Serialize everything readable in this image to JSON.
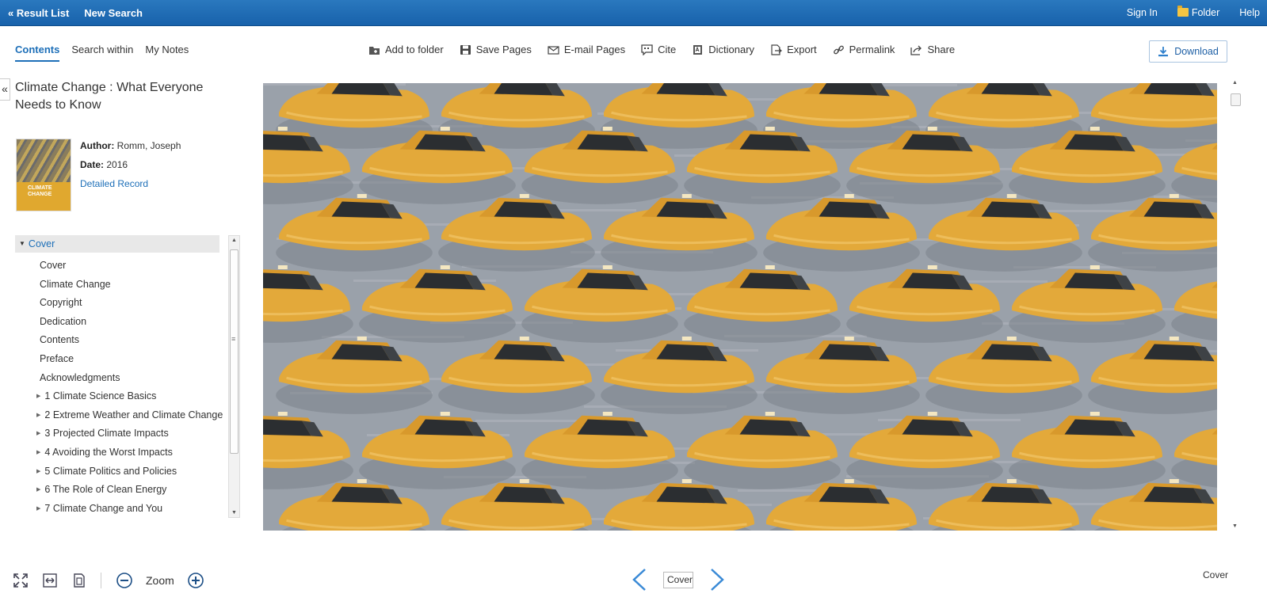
{
  "topbar": {
    "result_list": "« Result List",
    "new_search": "New Search",
    "sign_in": "Sign In",
    "folder": "Folder",
    "help": "Help"
  },
  "tabs": [
    "Contents",
    "Search within",
    "My Notes"
  ],
  "toolbar": {
    "add_to_folder": "Add to folder",
    "save_pages": "Save Pages",
    "email_pages": "E-mail Pages",
    "cite": "Cite",
    "dictionary": "Dictionary",
    "export": "Export",
    "permalink": "Permalink",
    "share": "Share",
    "download": "Download"
  },
  "book": {
    "title": "Climate Change : What Everyone Needs to Know",
    "author_label": "Author:",
    "author": "Romm, Joseph",
    "date_label": "Date:",
    "date": "2016",
    "detailed_record": "Detailed Record",
    "cover_text": "CLIMATE CHANGE"
  },
  "toc": {
    "head": "Cover",
    "items": [
      {
        "label": "Cover",
        "type": "sub"
      },
      {
        "label": "Climate Change",
        "type": "sub"
      },
      {
        "label": "Copyright",
        "type": "sub"
      },
      {
        "label": "Dedication",
        "type": "sub"
      },
      {
        "label": "Contents",
        "type": "sub"
      },
      {
        "label": "Preface",
        "type": "sub"
      },
      {
        "label": "Acknowledgments",
        "type": "sub"
      },
      {
        "label": "1 Climate Science Basics",
        "type": "chap"
      },
      {
        "label": "2 Extreme Weather and Climate Change",
        "type": "chap"
      },
      {
        "label": "3 Projected Climate Impacts",
        "type": "chap"
      },
      {
        "label": "4 Avoiding the Worst Impacts",
        "type": "chap"
      },
      {
        "label": "5 Climate Politics and Policies",
        "type": "chap"
      },
      {
        "label": "6 The Role of Clean Energy",
        "type": "chap"
      },
      {
        "label": "7 Climate Change and You",
        "type": "chap"
      }
    ]
  },
  "bottom": {
    "zoom_label": "Zoom",
    "page_input": "Cover",
    "page_label": "Cover"
  },
  "colors": {
    "topbar": "#1d6fb8",
    "link": "#1d6fb8",
    "taxi": "#e3a93a",
    "water": "#9aa1aa"
  }
}
